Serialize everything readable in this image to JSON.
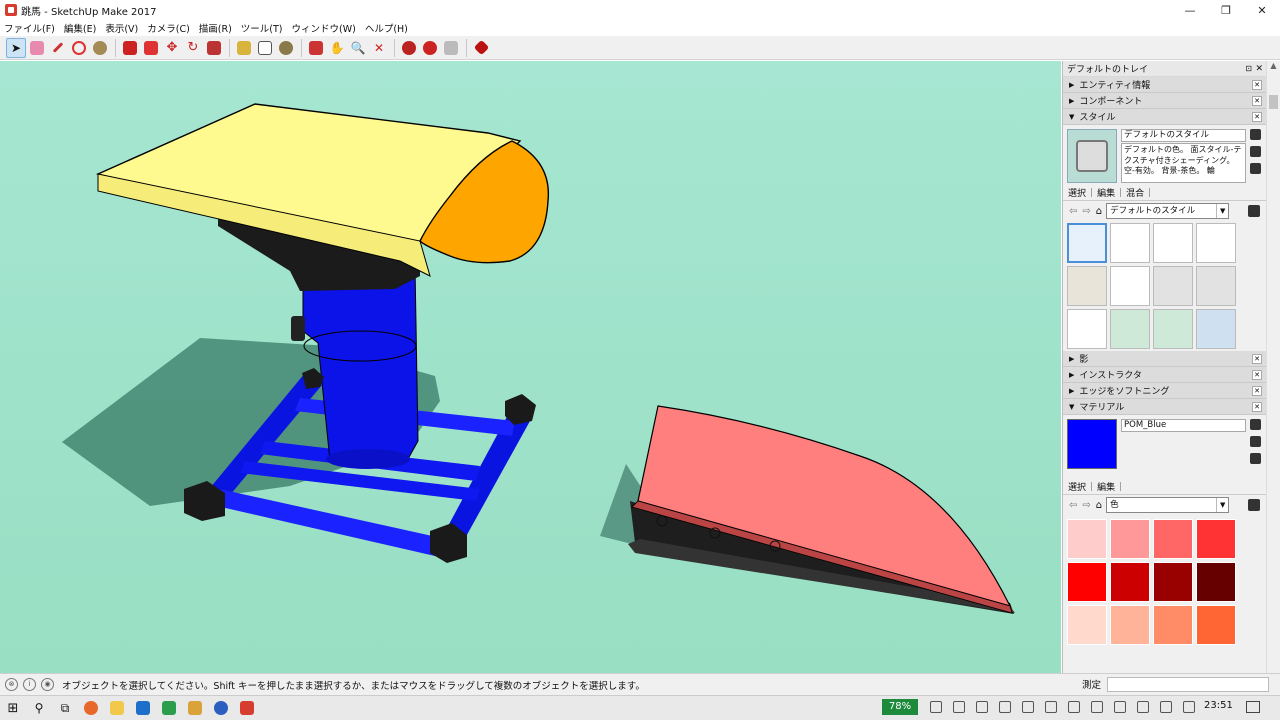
{
  "window": {
    "title": "跳馬 - SketchUp Make 2017",
    "minimize_glyph": "—",
    "maximize_glyph": "❐",
    "close_glyph": "✕"
  },
  "menu": [
    "ファイル(F)",
    "編集(E)",
    "表示(V)",
    "カメラ(C)",
    "描画(R)",
    "ツール(T)",
    "ウィンドウ(W)",
    "ヘルプ(H)"
  ],
  "toolbar": {
    "tools": [
      "select-icon",
      "eraser-icon",
      "pencil-icon",
      "arc-icon",
      "circle-icon",
      "push-pull-icon",
      "follow-me-icon",
      "move-icon",
      "rotate-icon",
      "scale-icon",
      "tape-measure-icon",
      "text-icon",
      "paint-bucket-icon",
      "orbit-icon",
      "pan-icon",
      "zoom-icon",
      "zoom-extents-icon",
      "warehouse-icon",
      "extension-icon",
      "share-icon",
      "ruby-icon"
    ],
    "accent": "#cc2a2a"
  },
  "tray": {
    "title": "デフォルトのトレイ",
    "pin_glyph": "⊡",
    "close_glyph": "✕",
    "sections": {
      "entity_info": "エンティティ情報",
      "components": "コンポーネント",
      "styles": "スタイル",
      "shadows": "影",
      "instructor": "インストラクタ",
      "soften_edges": "エッジをソフトニング",
      "materials": "マテリアル"
    },
    "style": {
      "name": "デフォルトのスタイル",
      "description": "デフォルトの色。 面スタイル-テクスチャ付きシェーディング。 空-有効。 背景-茶色。 輪",
      "tabs": [
        "選択",
        "編集",
        "混合"
      ],
      "library": "デフォルトのスタイル"
    },
    "material": {
      "name": "POM_Blue",
      "color": "#0000ff",
      "tabs": [
        "選択",
        "編集"
      ],
      "library": "色",
      "swatches": [
        "#ffcccc",
        "#ff9999",
        "#ff6666",
        "#ff3333",
        "#ff0000",
        "#cc0000",
        "#990000",
        "#660000",
        "#ffdacc",
        "#ffb399",
        "#ff8c66",
        "#ff6633"
      ]
    }
  },
  "status": {
    "message": "オブジェクトを選択してください。Shift キーを押したまま選択するか、またはマウスをドラッグして複数のオブジェクトを選択します。",
    "measure_label": "測定"
  },
  "taskbar": {
    "battery": "78%",
    "time": "23:51"
  }
}
